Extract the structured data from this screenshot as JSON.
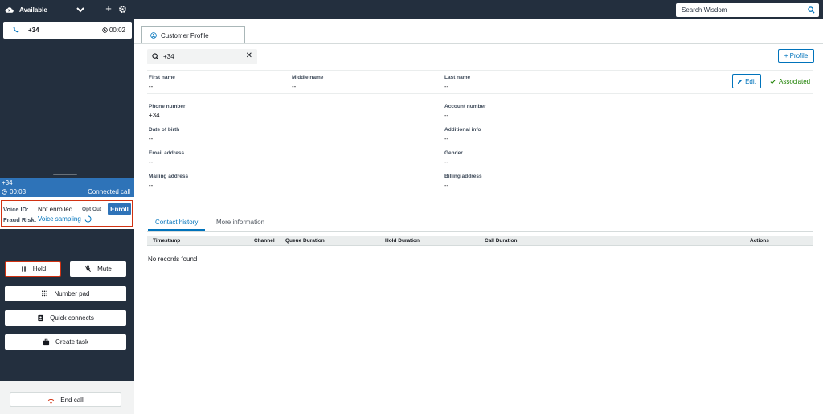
{
  "topbar": {
    "status_label": "Available",
    "search_placeholder": "Search Wisdom"
  },
  "ccp": {
    "contact_tile": {
      "number": "+34",
      "timer": "00:02"
    },
    "call": {
      "number": "+34",
      "elapsed": "00:03",
      "state": "Connected call"
    },
    "voice_id": {
      "label": "Voice ID:",
      "status": "Not enrolled",
      "opt_out_label": "Opt Out",
      "enroll_label": "Enroll",
      "fraud_label": "Fraud Risk:",
      "fraud_status": "Voice sampling"
    },
    "controls": {
      "hold_label": "Hold",
      "mute_label": "Mute",
      "numpad_label": "Number pad",
      "quick_connects_label": "Quick connects",
      "create_task_label": "Create task",
      "end_call_label": "End call"
    }
  },
  "main": {
    "tab_label": "Customer Profile",
    "search_value": "+34",
    "add_profile_label": "+ Profile",
    "edit_label": "Edit",
    "associated_label": "Associated",
    "fields": {
      "first_name": {
        "label": "First name",
        "value": "--"
      },
      "middle_name": {
        "label": "Middle name",
        "value": "--"
      },
      "last_name": {
        "label": "Last name",
        "value": "--"
      },
      "phone_number": {
        "label": "Phone number",
        "value": "+34"
      },
      "account_number": {
        "label": "Account number",
        "value": "--"
      },
      "date_of_birth": {
        "label": "Date of birth",
        "value": "--"
      },
      "additional_info": {
        "label": "Additional info",
        "value": "--"
      },
      "email_address": {
        "label": "Email address",
        "value": "--"
      },
      "gender": {
        "label": "Gender",
        "value": "--"
      },
      "mailing_address": {
        "label": "Mailing address",
        "value": "--"
      },
      "billing_address": {
        "label": "Billing address",
        "value": "--"
      }
    },
    "subtabs": [
      "Contact history",
      "More information"
    ],
    "table": {
      "columns": [
        "Timestamp",
        "Channel",
        "Queue Duration",
        "Hold Duration",
        "Call Duration",
        "Actions"
      ],
      "empty_text": "No records found"
    }
  },
  "colors": {
    "nav_dark": "#232f3e",
    "accent_blue": "#0073bb",
    "call_blue": "#2e73b8",
    "highlight_red": "#d13212",
    "success_green": "#1d8102"
  },
  "icons": [
    "cloud-icon",
    "chevron-down-icon",
    "plus-icon",
    "gear-icon",
    "search-icon",
    "phone-icon",
    "clock-icon",
    "user-circle-icon",
    "close-icon",
    "pencil-icon",
    "check-icon",
    "spinner-icon",
    "pause-icon",
    "mic-off-icon",
    "keypad-icon",
    "address-book-icon",
    "briefcase-icon",
    "hang-up-icon"
  ]
}
